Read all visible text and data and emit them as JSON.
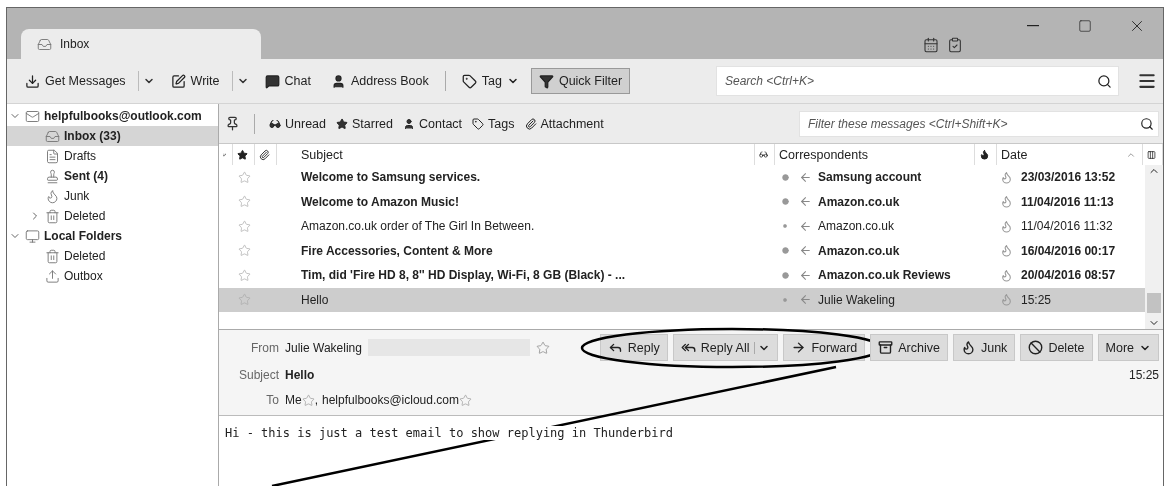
{
  "window": {
    "tab": {
      "title": "Inbox",
      "selected": true
    }
  },
  "toolbar": {
    "buttons": [
      {
        "label": "Get Messages",
        "kind": "split",
        "pressed": false
      },
      {
        "label": "Write",
        "kind": "split",
        "pressed": false
      },
      {
        "label": "Chat",
        "kind": "plain",
        "pressed": false
      },
      {
        "label": "Address Book",
        "kind": "plain",
        "pressed": false
      },
      {
        "label": "Tag",
        "kind": "menu",
        "pressed": false
      },
      {
        "label": "Quick Filter",
        "kind": "plain",
        "pressed": true
      }
    ],
    "search": {
      "placeholder": "Search <Ctrl+K>"
    }
  },
  "sidebar": {
    "accounts": [
      {
        "label": "helpfulbooks@outlook.com",
        "kind": "mail",
        "expanded": true,
        "children": [
          {
            "label": "Inbox (33)",
            "kind": "inbox",
            "unread": true,
            "selected": true
          },
          {
            "label": "Drafts",
            "kind": "drafts",
            "unread": false,
            "selected": false
          },
          {
            "label": "Sent (4)",
            "kind": "sent",
            "unread": true,
            "selected": false
          },
          {
            "label": "Junk",
            "kind": "junk",
            "unread": false,
            "selected": false
          },
          {
            "label": "Deleted",
            "kind": "trash",
            "unread": false,
            "selected": false,
            "expanded": false
          }
        ]
      },
      {
        "label": "Local Folders",
        "kind": "local",
        "expanded": true,
        "children": [
          {
            "label": "Deleted",
            "kind": "trash",
            "unread": false,
            "selected": false
          },
          {
            "label": "Outbox",
            "kind": "outbox",
            "unread": false,
            "selected": false
          }
        ]
      }
    ]
  },
  "quick_filter": {
    "items": [
      "Unread",
      "Starred",
      "Contact",
      "Tags",
      "Attachment"
    ],
    "placeholder": "Filter these messages <Ctrl+Shift+K>"
  },
  "messages": {
    "columns": [
      "Subject",
      "Correspondents",
      "Date"
    ],
    "rows": [
      {
        "subject": "Welcome to Samsung services.",
        "correspondent": "Samsung account",
        "date": "23/03/2016 13:52",
        "unread": true,
        "selected": false,
        "starred": false
      },
      {
        "subject": "Welcome to Amazon Music!",
        "correspondent": "Amazon.co.uk",
        "date": "11/04/2016 11:13",
        "unread": true,
        "selected": false,
        "starred": false
      },
      {
        "subject": "Amazon.co.uk order of The Girl In Between.",
        "correspondent": "Amazon.co.uk",
        "date": "11/04/2016 11:32",
        "unread": false,
        "selected": false,
        "starred": false
      },
      {
        "subject": "Fire Accessories, Content & More",
        "correspondent": "Amazon.co.uk",
        "date": "16/04/2016 00:17",
        "unread": true,
        "selected": false,
        "starred": false
      },
      {
        "subject": "Tim, did 'Fire HD 8, 8'' HD Display, Wi-Fi, 8 GB (Black) - ...",
        "correspondent": "Amazon.co.uk Reviews",
        "date": "20/04/2016 08:57",
        "unread": true,
        "selected": false,
        "starred": false
      },
      {
        "subject": "Hello",
        "correspondent": "Julie Wakeling",
        "date": "15:25",
        "unread": false,
        "selected": true,
        "starred": false
      }
    ]
  },
  "message_header": {
    "from_label": "From",
    "from": "Julie Wakeling",
    "subject_label": "Subject",
    "subject": "Hello",
    "to_label": "To",
    "to": [
      "Me",
      "helpfulbooks@icloud.com"
    ],
    "to_separator": ",",
    "time": "15:25",
    "buttons": [
      {
        "label": "Reply",
        "kind": "plain"
      },
      {
        "label": "Reply All",
        "kind": "split"
      },
      {
        "label": "Forward",
        "kind": "plain"
      },
      {
        "label": "Archive",
        "kind": "plain"
      },
      {
        "label": "Junk",
        "kind": "plain"
      },
      {
        "label": "Delete",
        "kind": "plain"
      },
      {
        "label": "More",
        "kind": "menu"
      }
    ]
  },
  "body": "Hi - this is just a test email to show replying in Thunderbird"
}
